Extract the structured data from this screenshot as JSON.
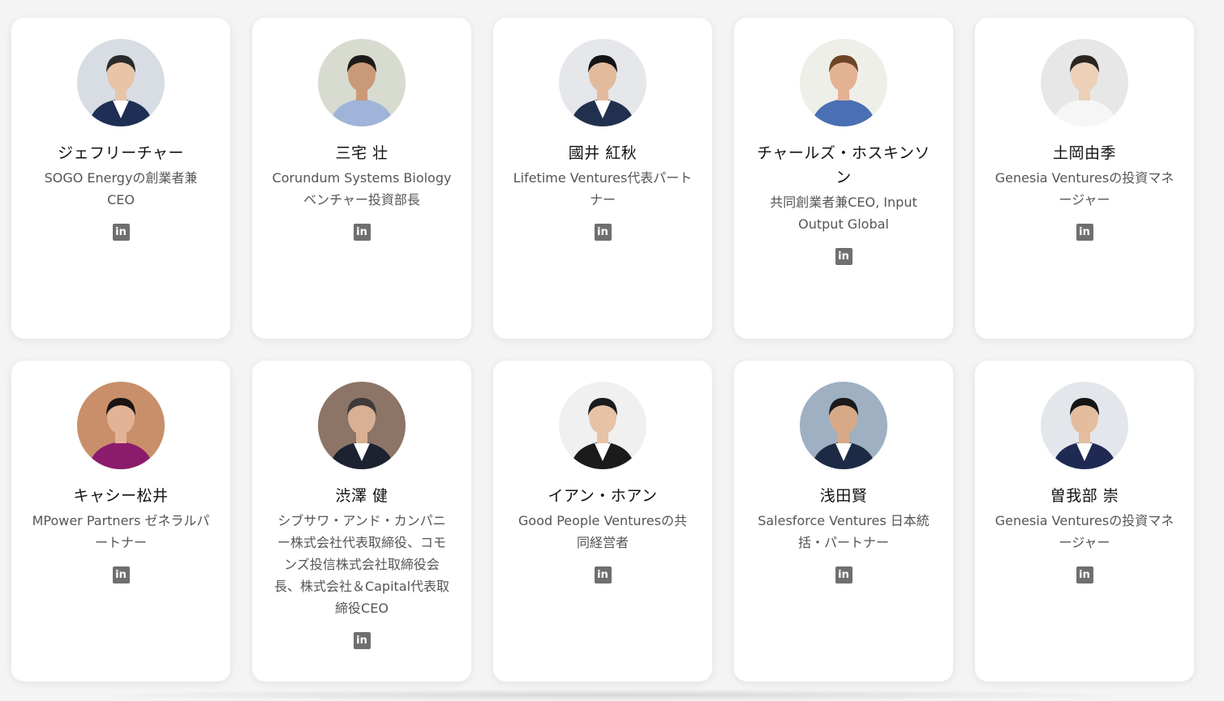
{
  "people": [
    {
      "name": "ジェフリーチャー",
      "role": "SOGO Energyの創業者兼CEO",
      "icon": "linkedin-icon",
      "bg": "#d7dde3",
      "skin": "#e8c4a8",
      "hair": "#2a2a2a",
      "suit": "#1f2e55",
      "shirt": "#ffffff"
    },
    {
      "name": "三宅 壮",
      "role": "Corundum Systems Biology ベンチャー投資部長",
      "icon": "linkedin-icon",
      "bg": "#d8dbd0",
      "skin": "#c99a78",
      "hair": "#1d1a17",
      "suit": "#9fb4d8",
      "shirt": "#9fb4d8"
    },
    {
      "name": "國井 紅秋",
      "role": "Lifetime Ventures代表パートナー",
      "icon": "linkedin-icon",
      "bg": "#e6e7ea",
      "skin": "#e2bb9c",
      "hair": "#141414",
      "suit": "#22304f",
      "shirt": "#ffffff"
    },
    {
      "name": "チャールズ・ホスキンソン",
      "role": "共同創業者兼CEO, Input Output Global",
      "icon": "linkedin-icon",
      "bg": "#efefe9",
      "skin": "#e3b293",
      "hair": "#6b4527",
      "suit": "#4a6fb4",
      "shirt": "#4a6fb4"
    },
    {
      "name": "土岡由季",
      "role": "Genesia Venturesの投資マネージャー",
      "icon": "linkedin-icon",
      "bg": "#e7e7e7",
      "skin": "#ecd0b8",
      "hair": "#2b2520",
      "suit": "#f6f6f6",
      "shirt": "#f6f6f6"
    },
    {
      "name": "キャシー松井",
      "role": "MPower Partners ゼネラルパートナー",
      "icon": "linkedin-icon",
      "bg": "#c88f6a",
      "skin": "#e2b495",
      "hair": "#1a1412",
      "suit": "#8b1c6c",
      "shirt": "#8b1c6c"
    },
    {
      "name": "渋澤 健",
      "role": "シブサワ・アンド・カンパニー株式会社代表取締役、コモンズ投信株式会社取締役会長、株式会社＆Capital代表取締役CEO",
      "icon": "linkedin-icon",
      "bg": "#8c7466",
      "skin": "#d8b093",
      "hair": "#3f3b39",
      "suit": "#1c2230",
      "shirt": "#ffffff"
    },
    {
      "name": "イアン・ホアン",
      "role": "Good People Venturesの共同経営者",
      "icon": "linkedin-icon",
      "bg": "#f0f0f0",
      "skin": "#e6c2a7",
      "hair": "#1b1b1b",
      "suit": "#1b1b1b",
      "shirt": "#ffffff"
    },
    {
      "name": "浅田賢",
      "role": "Salesforce Ventures 日本統括・パートナー",
      "icon": "linkedin-icon",
      "bg": "#9fb0c2",
      "skin": "#d7a987",
      "hair": "#1a1a1a",
      "suit": "#1d2a45",
      "shirt": "#ffffff"
    },
    {
      "name": "曽我部 崇",
      "role": "Genesia Venturesの投資マネージャー",
      "icon": "linkedin-icon",
      "bg": "#e3e7ec",
      "skin": "#e4bd9f",
      "hair": "#151515",
      "suit": "#1f2a52",
      "shirt": "#ffffff"
    }
  ],
  "linkedin_label": "in"
}
